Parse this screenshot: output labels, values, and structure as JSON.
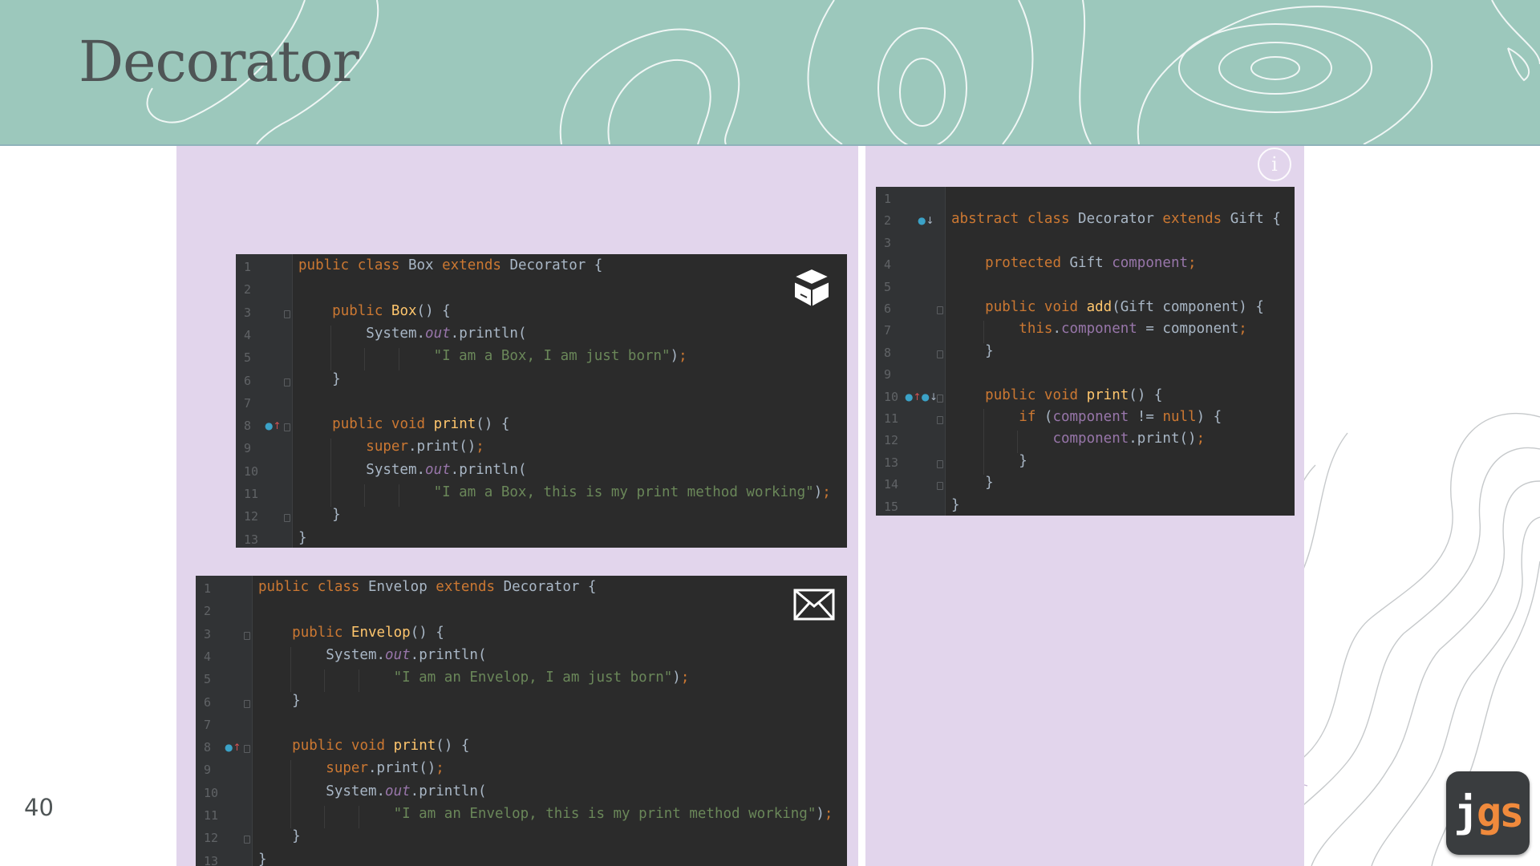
{
  "slide": {
    "title": "Decorator",
    "page_number": "40",
    "logo": {
      "j": "j",
      "gs": "gs"
    }
  },
  "icons": [
    "info-icon",
    "box-icon",
    "envelope-icon",
    "override-marker-icon",
    "implemented-marker-icon"
  ],
  "colors": {
    "banner": "#9cc8bc",
    "panel": "#e2d5ec",
    "editor_bg": "#2b2b2b",
    "keyword": "#cc7832",
    "string": "#6a8759",
    "method": "#ffc66d",
    "field": "#9876aa",
    "text": "#a9b7c6"
  },
  "code_blocks": {
    "box": {
      "lines": [
        [
          [
            "kw",
            "public "
          ],
          [
            "kw",
            "class "
          ],
          [
            "t",
            "Box "
          ],
          [
            "kw",
            "extends "
          ],
          [
            "t",
            "Decorator {"
          ]
        ],
        [],
        [
          [
            "t",
            "    "
          ],
          [
            "kw",
            "public "
          ],
          [
            "fn",
            "Box"
          ],
          [
            "t",
            "() {"
          ]
        ],
        [
          [
            "t",
            "        System."
          ],
          [
            "st",
            "out"
          ],
          [
            "t",
            ".println("
          ]
        ],
        [
          [
            "t",
            "                "
          ],
          [
            "str",
            "\"I am a Box, I am just born\""
          ],
          [
            "t",
            ")"
          ],
          [
            "kw",
            ";"
          ]
        ],
        [
          [
            "t",
            "    }"
          ]
        ],
        [],
        [
          [
            "t",
            "    "
          ],
          [
            "kw",
            "public void "
          ],
          [
            "fn",
            "print"
          ],
          [
            "t",
            "() {"
          ]
        ],
        [
          [
            "t",
            "        "
          ],
          [
            "kw",
            "super"
          ],
          [
            "t",
            ".print()"
          ],
          [
            "kw",
            ";"
          ]
        ],
        [
          [
            "t",
            "        System."
          ],
          [
            "st",
            "out"
          ],
          [
            "t",
            ".println("
          ]
        ],
        [
          [
            "t",
            "                "
          ],
          [
            "str",
            "\"I am a Box, this is my print method working\""
          ],
          [
            "t",
            ")"
          ],
          [
            "kw",
            ";"
          ]
        ],
        [
          [
            "t",
            "    }"
          ]
        ],
        [
          [
            "t",
            "}"
          ]
        ]
      ]
    },
    "envelop": {
      "lines": [
        [
          [
            "kw",
            "public "
          ],
          [
            "kw",
            "class "
          ],
          [
            "t",
            "Envelop "
          ],
          [
            "kw",
            "extends "
          ],
          [
            "t",
            "Decorator {"
          ]
        ],
        [],
        [
          [
            "t",
            "    "
          ],
          [
            "kw",
            "public "
          ],
          [
            "fn",
            "Envelop"
          ],
          [
            "t",
            "() {"
          ]
        ],
        [
          [
            "t",
            "        System."
          ],
          [
            "st",
            "out"
          ],
          [
            "t",
            ".println("
          ]
        ],
        [
          [
            "t",
            "                "
          ],
          [
            "str",
            "\"I am an Envelop, I am just born\""
          ],
          [
            "t",
            ")"
          ],
          [
            "kw",
            ";"
          ]
        ],
        [
          [
            "t",
            "    }"
          ]
        ],
        [],
        [
          [
            "t",
            "    "
          ],
          [
            "kw",
            "public void "
          ],
          [
            "fn",
            "print"
          ],
          [
            "t",
            "() {"
          ]
        ],
        [
          [
            "t",
            "        "
          ],
          [
            "kw",
            "super"
          ],
          [
            "t",
            ".print()"
          ],
          [
            "kw",
            ";"
          ]
        ],
        [
          [
            "t",
            "        System."
          ],
          [
            "st",
            "out"
          ],
          [
            "t",
            ".println("
          ]
        ],
        [
          [
            "t",
            "                "
          ],
          [
            "str",
            "\"I am an Envelop, this is my print method working\""
          ],
          [
            "t",
            ")"
          ],
          [
            "kw",
            ";"
          ]
        ],
        [
          [
            "t",
            "    }"
          ]
        ],
        [
          [
            "t",
            "}"
          ]
        ]
      ]
    },
    "decorator": {
      "lines": [
        [],
        [
          [
            "kw",
            "abstract "
          ],
          [
            "kw",
            "class "
          ],
          [
            "t",
            "Decorator "
          ],
          [
            "kw",
            "extends "
          ],
          [
            "t",
            "Gift {"
          ]
        ],
        [],
        [
          [
            "t",
            "    "
          ],
          [
            "kw",
            "protected "
          ],
          [
            "t",
            "Gift "
          ],
          [
            "fld",
            "component"
          ],
          [
            "kw",
            ";"
          ]
        ],
        [],
        [
          [
            "t",
            "    "
          ],
          [
            "kw",
            "public void "
          ],
          [
            "fn",
            "add"
          ],
          [
            "t",
            "(Gift component) {"
          ]
        ],
        [
          [
            "t",
            "        "
          ],
          [
            "kw",
            "this"
          ],
          [
            "t",
            "."
          ],
          [
            "fld",
            "component"
          ],
          [
            "t",
            " = component"
          ],
          [
            "kw",
            ";"
          ]
        ],
        [
          [
            "t",
            "    }"
          ]
        ],
        [],
        [
          [
            "t",
            "    "
          ],
          [
            "kw",
            "public void "
          ],
          [
            "fn",
            "print"
          ],
          [
            "t",
            "() {"
          ]
        ],
        [
          [
            "t",
            "        "
          ],
          [
            "kw",
            "if "
          ],
          [
            "t",
            "("
          ],
          [
            "fld",
            "component"
          ],
          [
            "t",
            " != "
          ],
          [
            "kw",
            "null"
          ],
          [
            "t",
            ") {"
          ]
        ],
        [
          [
            "t",
            "            "
          ],
          [
            "fld",
            "component"
          ],
          [
            "t",
            ".print()"
          ],
          [
            "kw",
            ";"
          ]
        ],
        [
          [
            "t",
            "        }"
          ]
        ],
        [
          [
            "t",
            "    }"
          ]
        ],
        [
          [
            "t",
            "}"
          ]
        ]
      ]
    }
  }
}
